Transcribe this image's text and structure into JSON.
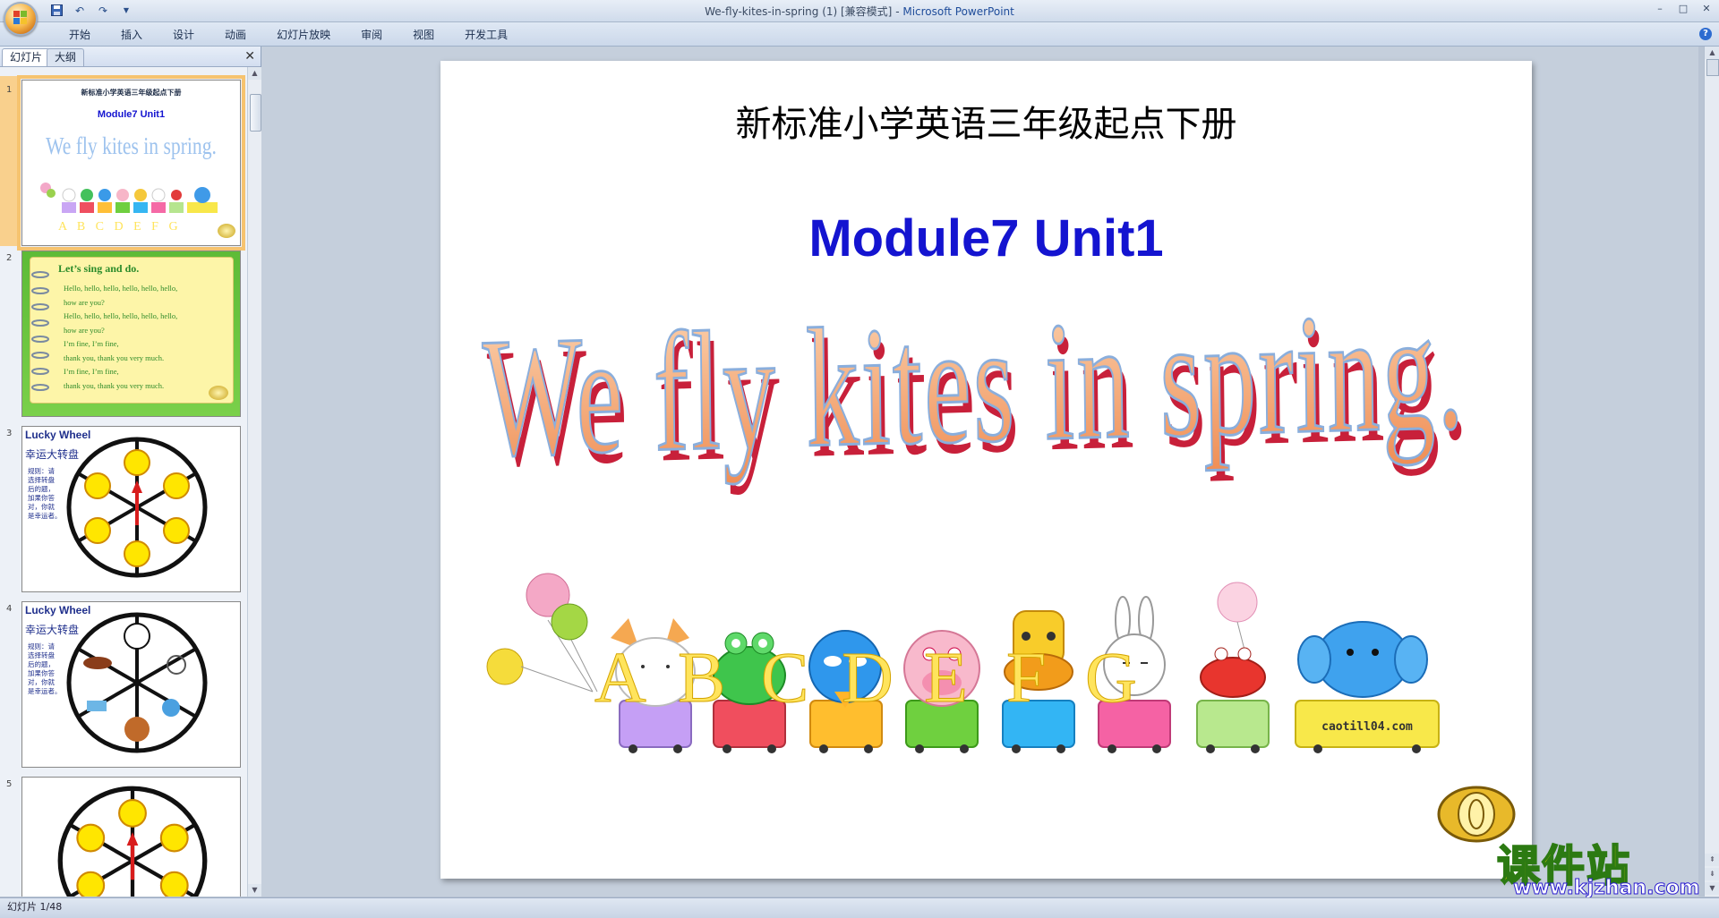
{
  "window": {
    "title_doc": "We-fly-kites-in-spring (1) [兼容模式]",
    "title_sep": " - ",
    "title_app": "Microsoft PowerPoint",
    "min": "–",
    "max": "□",
    "close": "✕"
  },
  "ribbon": {
    "tabs": [
      "开始",
      "插入",
      "设计",
      "动画",
      "幻灯片放映",
      "审阅",
      "视图",
      "开发工具"
    ]
  },
  "pane": {
    "tab_slides": "幻灯片",
    "tab_outline": "大纲",
    "close": "✕"
  },
  "thumbnails": [
    {
      "num": "1",
      "line1": "新标准小学英语三年级起点下册",
      "line2": "Module7 Unit1",
      "line3": "We fly kites in spring.",
      "letters": "A B C D E F G"
    },
    {
      "num": "2",
      "heading": "Let’s sing and do.",
      "lines": [
        "Hello, hello, hello, hello, hello, hello,",
        "how are you?",
        "Hello, hello, hello, hello, hello, hello,",
        "how are you?",
        "I’m fine, I’m fine,",
        "thank you, thank you very much.",
        "I’m fine, I’m fine,",
        "thank you, thank you very much."
      ]
    },
    {
      "num": "3",
      "title": "Lucky Wheel",
      "subtitle": "幸运大转盘",
      "rule": "规则：请\n选择转盘\n后的题，\n加果你答\n对，你就\n是幸运者。"
    },
    {
      "num": "4",
      "title": "Lucky Wheel",
      "subtitle": "幸运大转盘",
      "rule": "规则：请\n选择转盘\n后的题，\n加果你答\n对，你就\n是幸运者。"
    },
    {
      "num": "5"
    }
  ],
  "status": {
    "slide_indicator": "幻灯片 1/48"
  },
  "slide": {
    "subtitle": "新标准小学英语三年级起点下册",
    "module": "Module7 Unit1",
    "headline": "We fly kites in spring.",
    "letters": [
      "A",
      "B",
      "C",
      "D",
      "E",
      "F",
      "G"
    ],
    "train_brand": "caotill04.com",
    "watermark_cn": "课件站",
    "watermark_url": "www.kjzhan.com"
  },
  "colors": {
    "module_blue": "#1414d0",
    "letter_yellow": "#ffe45c",
    "headline_fill": "#f4aa7a",
    "headline_shadow": "#c8203a"
  }
}
